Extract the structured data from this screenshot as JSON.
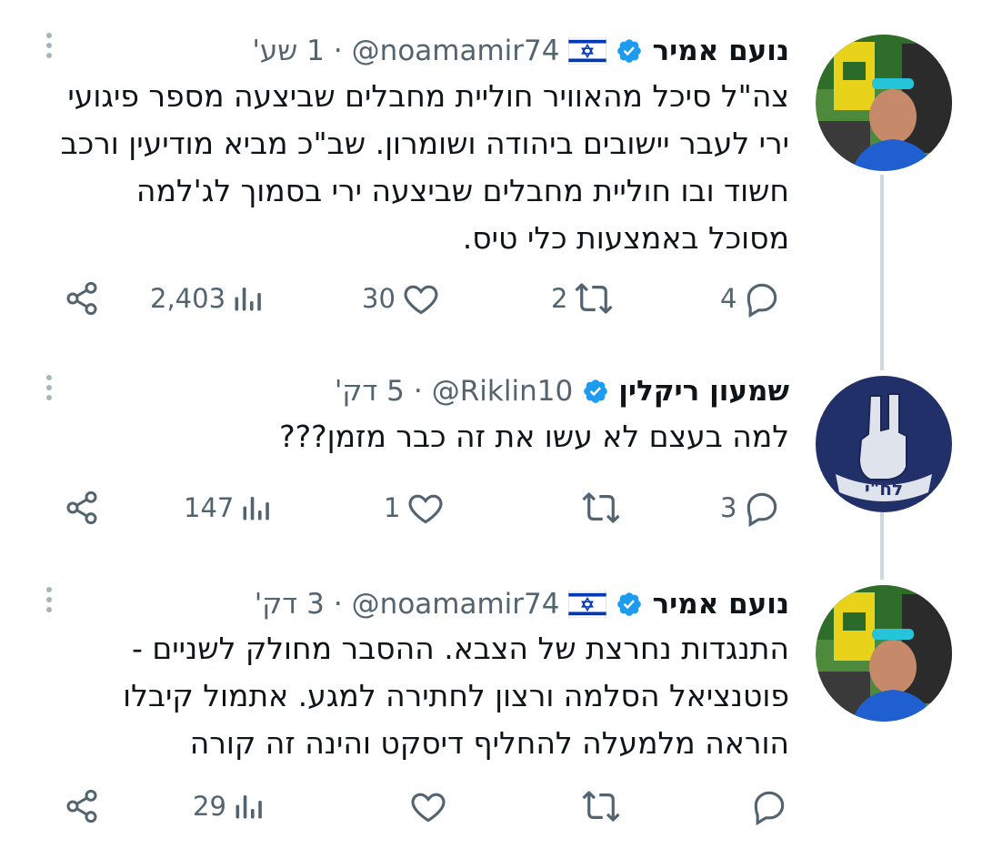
{
  "tweets": [
    {
      "name": "נועם אמיר",
      "handle": "@noamamir74",
      "separator": "·",
      "time": "1 שע'",
      "lines": [
        "צה\"ל סיכל מהאוויר חוליית מחבלים שביצעה מספר פיגועי",
        "ירי לעבר יישובים ביהודה ושומרון. שב\"כ מביא מודיעין ורכב",
        "חשוד ובו חוליית מחבלים שביצעה ירי בסמוך לג'למה",
        "מסוכל באמצעות כלי טיס."
      ],
      "views": "2,403",
      "likes": "30",
      "reposts": "2",
      "replies": "4",
      "has_flag": true,
      "avatar_icon": "profile-photo"
    },
    {
      "name": "שמעון ריקלין",
      "handle": "@Riklin10",
      "separator": "·",
      "time": "5 דק'",
      "lines": [
        "למה בעצם לא עשו את זה כבר מזמן???"
      ],
      "views": "147",
      "likes": "1",
      "reposts": "",
      "replies": "3",
      "has_flag": false,
      "avatar_icon": "fist-emblem",
      "avatar_text": "לח\"י"
    },
    {
      "name": "נועם אמיר",
      "handle": "@noamamir74",
      "separator": "·",
      "time": "3 דק'",
      "lines": [
        "התנגדות נחרצת של הצבא. ההסבר מחולק לשניים -",
        "פוטנציאל הסלמה ורצון לחתירה למגע. אתמול קיבלו",
        "הוראה מלמעלה להחליף דיסקט והינה זה קורה"
      ],
      "views": "29",
      "likes": "",
      "reposts": "",
      "replies": "",
      "has_flag": true,
      "avatar_icon": "profile-photo"
    }
  ],
  "colors": {
    "text": "#0f1419",
    "secondary": "#536471",
    "verified": "#1d9bf0",
    "thread_line": "#cfd9de",
    "flag_blue": "#0038b8"
  }
}
